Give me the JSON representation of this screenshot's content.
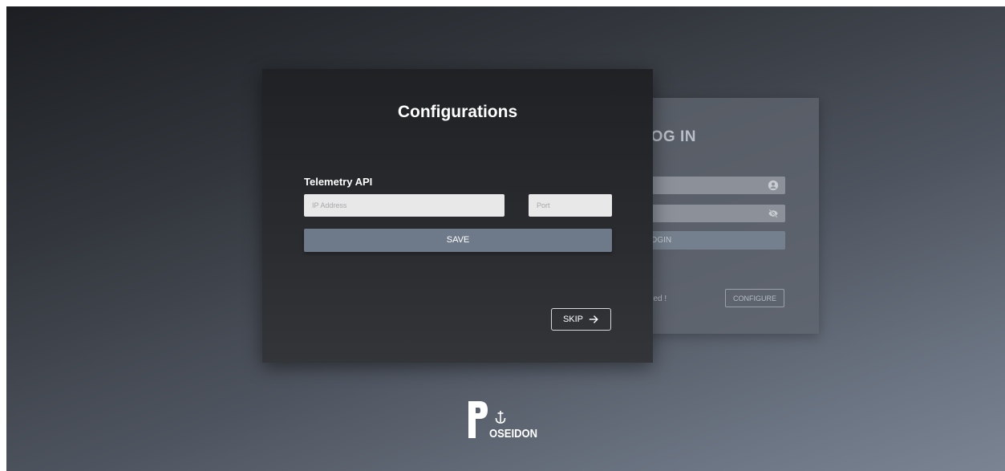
{
  "login": {
    "title_fragment": "OG IN",
    "login_button": "LOGIN",
    "note_fragment": "gured !",
    "configure_button": "CONFIGURE",
    "user_icon": "user-circle-icon",
    "password_icon": "eye-slash-icon"
  },
  "config": {
    "title": "Configurations",
    "section_label": "Telemetry API",
    "ip_placeholder": "IP Address",
    "ip_value": "",
    "port_placeholder": "Port",
    "port_value": "",
    "save_label": "SAVE",
    "skip_label": "SKIP",
    "skip_icon": "arrow-right-icon"
  },
  "brand": {
    "logo_text": "POSEIDON",
    "logo_icon": "anchor-icon"
  },
  "colors": {
    "save_button": "#6e7a89",
    "card_background": "#232528",
    "text": "#ffffff"
  }
}
